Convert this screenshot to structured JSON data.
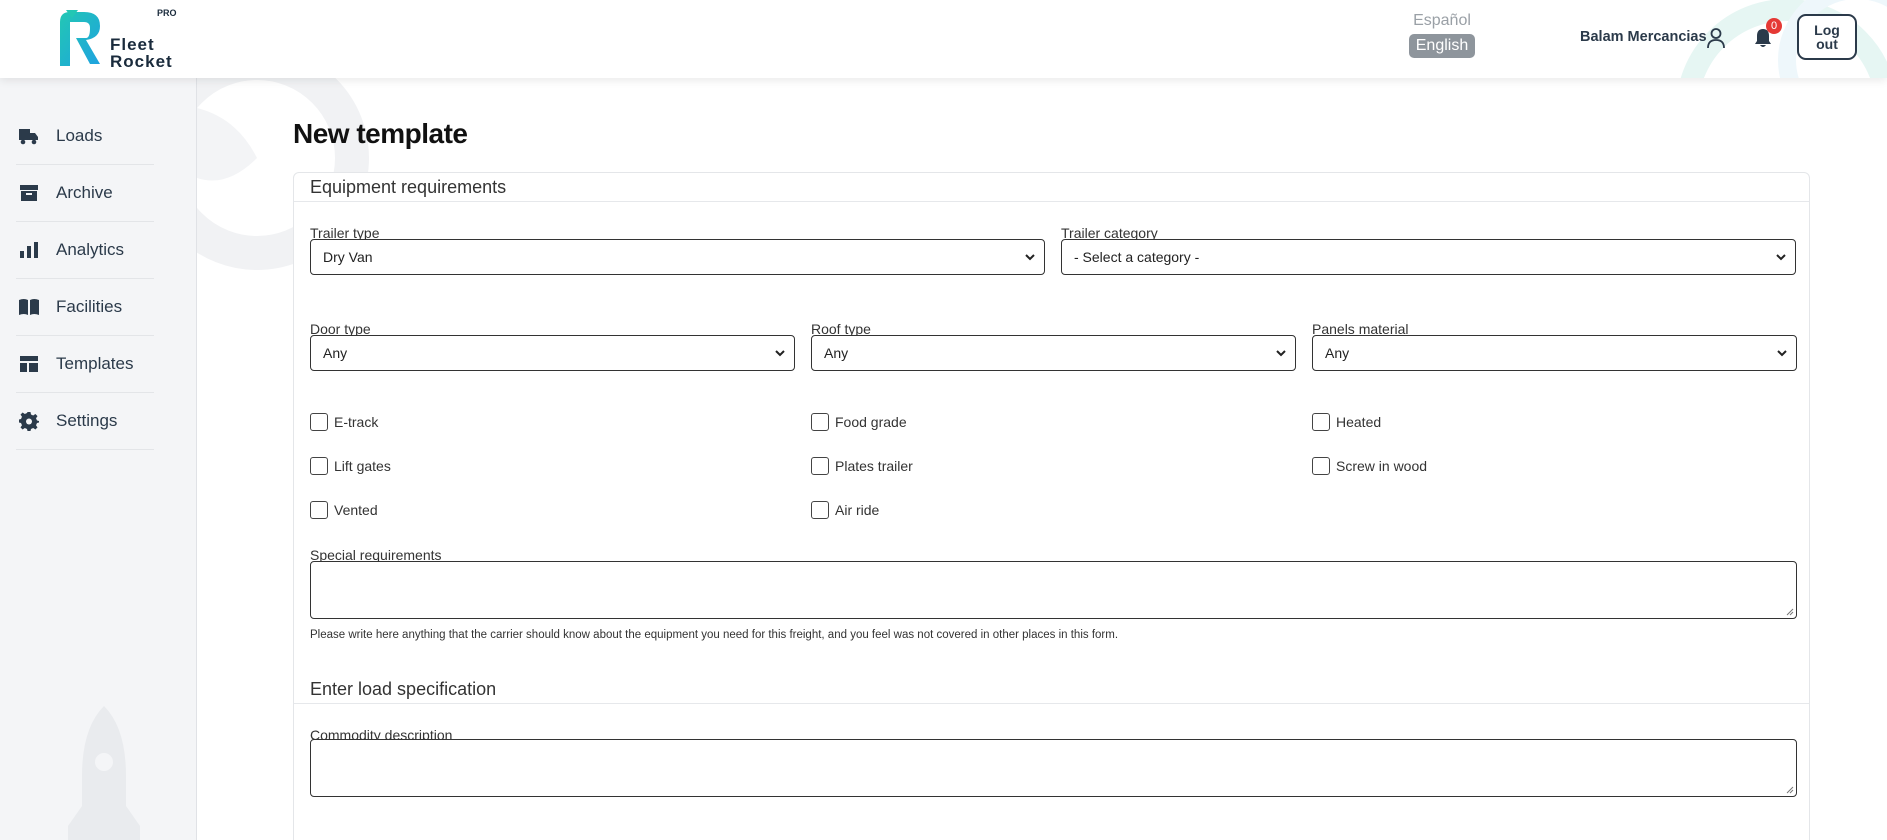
{
  "header": {
    "logo_pro": "PRO",
    "logo_line1": "Fleet",
    "logo_line2": "Rocket",
    "lang_es": "Español",
    "lang_en": "English",
    "user_name": "Balam Mercancias",
    "notification_count": "0",
    "logout_label": "Log out",
    "colors": {
      "brand_teal": "#22c7b4",
      "brand_blue": "#1fa2e0",
      "text_dark": "#2b3a4a",
      "badge_red": "#e53935"
    }
  },
  "sidebar": {
    "items": [
      {
        "label": "Loads",
        "icon": "truck-icon"
      },
      {
        "label": "Archive",
        "icon": "archive-box-icon"
      },
      {
        "label": "Analytics",
        "icon": "bar-chart-icon"
      },
      {
        "label": "Facilities",
        "icon": "book-open-icon"
      },
      {
        "label": "Templates",
        "icon": "layout-template-icon"
      },
      {
        "label": "Settings",
        "icon": "gear-icon"
      }
    ]
  },
  "main": {
    "page_title": "New template",
    "equipment": {
      "section_title": "Equipment requirements",
      "trailer_type_label": "Trailer type",
      "trailer_type_value": "Dry Van",
      "trailer_category_label": "Trailer category",
      "trailer_category_value": "- Select a category -",
      "door_type_label": "Door type",
      "door_type_value": "Any",
      "roof_type_label": "Roof type",
      "roof_type_value": "Any",
      "panels_material_label": "Panels material",
      "panels_material_value": "Any",
      "checkboxes": {
        "etrack": "E-track",
        "food_grade": "Food grade",
        "heated": "Heated",
        "lift_gates": "Lift gates",
        "plates_trailer": "Plates trailer",
        "screw_in_wood": "Screw in wood",
        "vented": "Vented",
        "air_ride": "Air ride"
      },
      "special_requirements_label": "Special requirements",
      "special_requirements_value": "",
      "special_requirements_help": "Please write here anything that the carrier should know about the equipment you need for this freight, and you feel was not covered in other places in this form."
    },
    "load_spec": {
      "section_title": "Enter load specification",
      "commodity_label": "Commodity description",
      "commodity_value": ""
    }
  }
}
